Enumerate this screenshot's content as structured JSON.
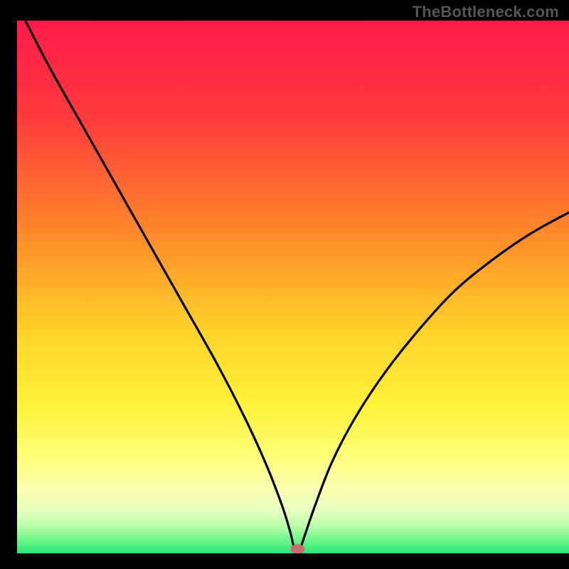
{
  "watermark": "TheBottleneck.com",
  "chart_data": {
    "type": "line",
    "title": "",
    "xlabel": "",
    "ylabel": "",
    "xlim": [
      0,
      100
    ],
    "ylim": [
      0,
      100
    ],
    "gradient_stops": [
      {
        "offset": 0,
        "color": "#ff1a49"
      },
      {
        "offset": 18,
        "color": "#ff3a3d"
      },
      {
        "offset": 40,
        "color": "#ff8a2a"
      },
      {
        "offset": 58,
        "color": "#ffd22a"
      },
      {
        "offset": 72,
        "color": "#fff23a"
      },
      {
        "offset": 82,
        "color": "#fcff7a"
      },
      {
        "offset": 88,
        "color": "#fbffb2"
      },
      {
        "offset": 92,
        "color": "#e8ffc0"
      },
      {
        "offset": 95,
        "color": "#b7ffa8"
      },
      {
        "offset": 97,
        "color": "#7cf98f"
      },
      {
        "offset": 100,
        "color": "#27e57a"
      }
    ],
    "series": [
      {
        "name": "curve",
        "points": [
          {
            "x": 1.5,
            "y": 100
          },
          {
            "x": 6,
            "y": 91
          },
          {
            "x": 12,
            "y": 80
          },
          {
            "x": 18,
            "y": 69
          },
          {
            "x": 24,
            "y": 58
          },
          {
            "x": 30,
            "y": 47
          },
          {
            "x": 36,
            "y": 36
          },
          {
            "x": 41,
            "y": 26
          },
          {
            "x": 45,
            "y": 17
          },
          {
            "x": 48,
            "y": 9
          },
          {
            "x": 49.5,
            "y": 4
          },
          {
            "x": 50.3,
            "y": 0.8
          },
          {
            "x": 51.2,
            "y": 0.8
          },
          {
            "x": 52,
            "y": 3
          },
          {
            "x": 54,
            "y": 9
          },
          {
            "x": 57,
            "y": 17
          },
          {
            "x": 61,
            "y": 25
          },
          {
            "x": 66,
            "y": 33
          },
          {
            "x": 72,
            "y": 41
          },
          {
            "x": 79,
            "y": 49
          },
          {
            "x": 86,
            "y": 55
          },
          {
            "x": 93,
            "y": 60
          },
          {
            "x": 100,
            "y": 64
          }
        ]
      }
    ],
    "marker": {
      "x": 50.8,
      "y": 0.8,
      "rx": 1.3,
      "ry": 0.9,
      "color": "#c96d6d"
    }
  }
}
